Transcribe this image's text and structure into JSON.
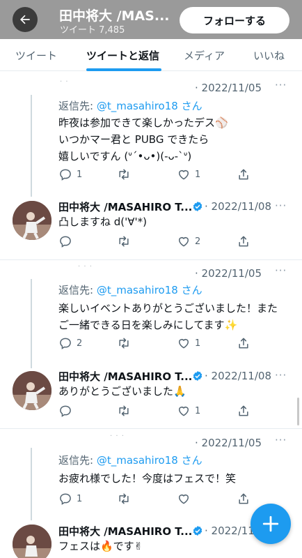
{
  "header": {
    "title": "田中将大 /MAS...",
    "tweet_count": "ツイート 7,485",
    "follow_label": "フォローする"
  },
  "tabs": [
    "ツイート",
    "ツイートと返信",
    "メディア",
    "いいね"
  ],
  "threads": [
    {
      "fan": {
        "date": "· 2022/11/05",
        "reply_prefix": "返信先: ",
        "reply_handle": "@t_masahiro18 さん",
        "lines": [
          "昨夜は参加できて楽しかったデス⚾",
          "いつかマー君と PUBG できたら",
          "嬉しいですん (ᐡ´•ᴗ•)(-ᴗ-`ᐡ)"
        ],
        "reply_count": "1",
        "retweet_count": "",
        "like_count": "1"
      },
      "tanaka": {
        "name": "田中将大 /MASAHIRO T...",
        "date": "· 2022/11/08",
        "lines": [
          "凸しますね d('∀'*)"
        ],
        "reply_count": "",
        "retweet_count": "",
        "like_count": "2"
      }
    },
    {
      "fan": {
        "date": "· 2022/11/05",
        "reply_prefix": "返信先: ",
        "reply_handle": "@t_masahiro18 さん",
        "lines": [
          "楽しいイベントありがとうございました！また",
          "ご一緒できる日を楽しみにしてます✨"
        ],
        "reply_count": "2",
        "retweet_count": "",
        "like_count": "1"
      },
      "tanaka": {
        "name": "田中将大 /MASAHIRO T...",
        "date": "· 2022/11/08",
        "lines": [
          "ありがとうございました🙏"
        ],
        "reply_count": "",
        "retweet_count": "",
        "like_count": "1"
      }
    },
    {
      "fan": {
        "date": "· 2022/11/05",
        "reply_prefix": "返信先: ",
        "reply_handle": "@t_masahiro18 さん",
        "lines": [
          "お疲れ様でした！今度はフェスで！笑"
        ],
        "reply_count": "1",
        "retweet_count": "",
        "like_count": ""
      },
      "tanaka": {
        "name": "田中将大 /MASAHIRO T...",
        "date": "· 2022/11/",
        "lines": [
          "フェスは🔥です✌"
        ]
      }
    }
  ],
  "more_glyph": "···",
  "colors": {
    "accent": "#1d9bf0",
    "header_bg": "#9a9a9a",
    "text_secondary": "#536471"
  },
  "icons": [
    "back-arrow-icon",
    "verified-badge-icon",
    "reply-icon",
    "retweet-icon",
    "like-icon",
    "share-icon",
    "compose-plus-icon"
  ]
}
